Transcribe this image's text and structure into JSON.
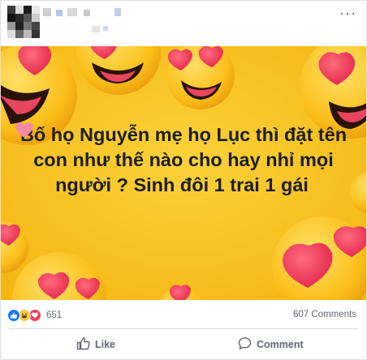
{
  "post": {
    "author": "",
    "image_text": "Bố họ Nguyễn mẹ họ Lục thì đặt tên con như thế nào cho hay nhỉ mọi người ? Sinh đôi 1 trai 1 gái"
  },
  "reactions": {
    "icons": [
      "like-reaction",
      "haha-reaction",
      "love-reaction"
    ],
    "count": "651"
  },
  "comments": {
    "count_label": "607 Comments"
  },
  "actions": {
    "like_label": "Like",
    "comment_label": "Comment"
  },
  "colors": {
    "background_yellow": "#f6c51b",
    "like_blue": "#1877f2",
    "love_red": "#f33e58"
  }
}
